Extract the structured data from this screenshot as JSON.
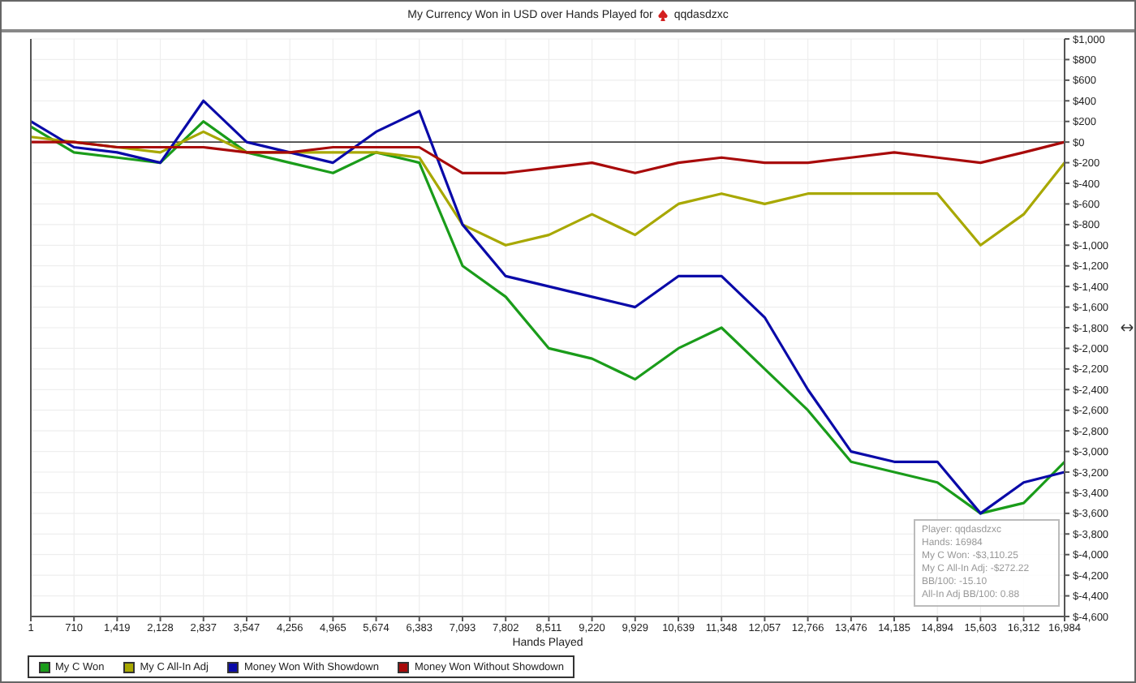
{
  "chart": {
    "title": "My Currency Won in USD over Hands Played for",
    "player": "qqdasdzxc",
    "chart_data": {
      "type": "line",
      "grid": true,
      "xlabel": "Hands Played",
      "x": [
        1,
        710,
        1419,
        2128,
        2837,
        3547,
        4256,
        4965,
        5674,
        6383,
        7093,
        7802,
        8511,
        9220,
        9929,
        10639,
        11348,
        12057,
        12766,
        13476,
        14185,
        14894,
        15603,
        16312,
        16984
      ],
      "series": [
        {
          "name": "My C Won",
          "color": "#1a9c1a",
          "values": [
            150,
            -100,
            -150,
            -200,
            200,
            -100,
            -200,
            -300,
            -100,
            -200,
            -1200,
            -1500,
            -2000,
            -2100,
            -2300,
            -2000,
            -1800,
            -2200,
            -2600,
            -3100,
            -3200,
            -3300,
            -3600,
            -3500,
            -3100
          ]
        },
        {
          "name": "My C All-In Adj",
          "color": "#a8a800",
          "values": [
            50,
            0,
            -50,
            -100,
            100,
            -100,
            -100,
            -100,
            -100,
            -150,
            -800,
            -1000,
            -900,
            -700,
            -900,
            -600,
            -500,
            -600,
            -500,
            -500,
            -500,
            -500,
            -1000,
            -700,
            -200
          ]
        },
        {
          "name": "Money Won With Showdown",
          "color": "#0a0aa8",
          "values": [
            200,
            -50,
            -100,
            -200,
            400,
            0,
            -100,
            -200,
            100,
            300,
            -800,
            -1300,
            -1400,
            -1500,
            -1600,
            -1300,
            -1300,
            -1700,
            -2400,
            -3000,
            -3100,
            -3100,
            -3600,
            -3300,
            -3200
          ]
        },
        {
          "name": "Money Won Without Showdown",
          "color": "#a80a0a",
          "values": [
            0,
            0,
            -50,
            -50,
            -50,
            -100,
            -100,
            -50,
            -50,
            -50,
            -300,
            -300,
            -250,
            -200,
            -300,
            -200,
            -150,
            -200,
            -200,
            -150,
            -100,
            -150,
            -200,
            -100,
            0
          ]
        }
      ],
      "xlim": [
        1,
        16984
      ],
      "ylim": [
        -4600,
        1000
      ],
      "xticks": [
        {
          "value": 1,
          "label": "1"
        },
        {
          "value": 710,
          "label": "710"
        },
        {
          "value": 1419,
          "label": "1,419"
        },
        {
          "value": 2128,
          "label": "2,128"
        },
        {
          "value": 2837,
          "label": "2,837"
        },
        {
          "value": 3547,
          "label": "3,547"
        },
        {
          "value": 4256,
          "label": "4,256"
        },
        {
          "value": 4965,
          "label": "4,965"
        },
        {
          "value": 5674,
          "label": "5,674"
        },
        {
          "value": 6383,
          "label": "6,383"
        },
        {
          "value": 7093,
          "label": "7,093"
        },
        {
          "value": 7802,
          "label": "7,802"
        },
        {
          "value": 8511,
          "label": "8,511"
        },
        {
          "value": 9220,
          "label": "9,220"
        },
        {
          "value": 9929,
          "label": "9,929"
        },
        {
          "value": 10639,
          "label": "10,639"
        },
        {
          "value": 11348,
          "label": "11,348"
        },
        {
          "value": 12057,
          "label": "12,057"
        },
        {
          "value": 12766,
          "label": "12,766"
        },
        {
          "value": 13476,
          "label": "13,476"
        },
        {
          "value": 14185,
          "label": "14,185"
        },
        {
          "value": 14894,
          "label": "14,894"
        },
        {
          "value": 15603,
          "label": "15,603"
        },
        {
          "value": 16312,
          "label": "16,312"
        },
        {
          "value": 16984,
          "label": "16,984"
        }
      ],
      "yticks": [
        {
          "value": 1000,
          "label": "$1,000"
        },
        {
          "value": 800,
          "label": "$800"
        },
        {
          "value": 600,
          "label": "$600"
        },
        {
          "value": 400,
          "label": "$400"
        },
        {
          "value": 200,
          "label": "$200"
        },
        {
          "value": 0,
          "label": "$0"
        },
        {
          "value": -200,
          "label": "$-200"
        },
        {
          "value": -400,
          "label": "$-400"
        },
        {
          "value": -600,
          "label": "$-600"
        },
        {
          "value": -800,
          "label": "$-800"
        },
        {
          "value": -1000,
          "label": "$-1,000"
        },
        {
          "value": -1200,
          "label": "$-1,200"
        },
        {
          "value": -1400,
          "label": "$-1,400"
        },
        {
          "value": -1600,
          "label": "$-1,600"
        },
        {
          "value": -1800,
          "label": "$-1,800"
        },
        {
          "value": -2000,
          "label": "$-2,000"
        },
        {
          "value": -2200,
          "label": "$-2,200"
        },
        {
          "value": -2400,
          "label": "$-2,400"
        },
        {
          "value": -2600,
          "label": "$-2,600"
        },
        {
          "value": -2800,
          "label": "$-2,800"
        },
        {
          "value": -3000,
          "label": "$-3,000"
        },
        {
          "value": -3200,
          "label": "$-3,200"
        },
        {
          "value": -3400,
          "label": "$-3,400"
        },
        {
          "value": -3600,
          "label": "$-3,600"
        },
        {
          "value": -3800,
          "label": "$-3,800"
        },
        {
          "value": -4000,
          "label": "$-4,000"
        },
        {
          "value": -4200,
          "label": "$-4,200"
        },
        {
          "value": -4400,
          "label": "$-4,400"
        },
        {
          "value": -4600,
          "label": "$-4,600"
        }
      ]
    }
  },
  "tooltip": {
    "lines": [
      "Player: qqdasdzxc",
      "Hands: 16984",
      "My C Won: -$3,110.25",
      "My C All-In Adj: -$272.22",
      "BB/100: -15.10",
      "All-In Adj BB/100: 0.88"
    ]
  }
}
